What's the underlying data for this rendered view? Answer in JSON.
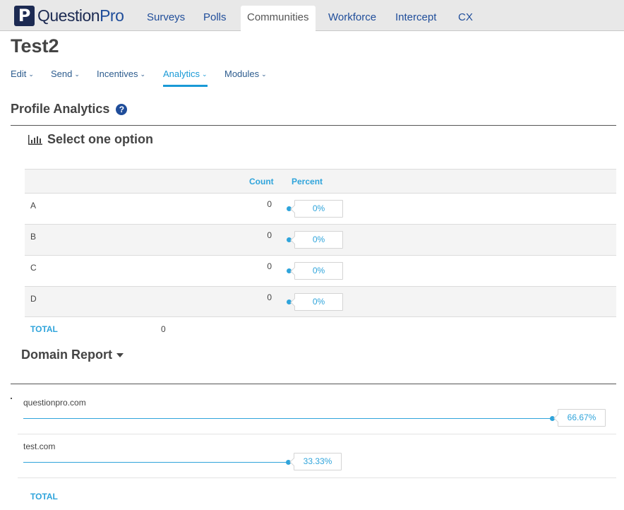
{
  "app": {
    "logo_letter": "P",
    "logo_text_main": "Question",
    "logo_text_accent": "Pro",
    "brand_color": "#1c2a52",
    "accent_color": "#2fa4db"
  },
  "topnav": {
    "items": [
      {
        "label": "Surveys",
        "active": false
      },
      {
        "label": "Polls",
        "active": false
      },
      {
        "label": "Communities",
        "active": true
      },
      {
        "label": "Workforce",
        "active": false
      },
      {
        "label": "Intercept",
        "active": false
      },
      {
        "label": "CX",
        "active": false
      }
    ]
  },
  "page": {
    "title": "Test2"
  },
  "subnav": {
    "items": [
      {
        "label": "Edit",
        "active": false
      },
      {
        "label": "Send",
        "active": false
      },
      {
        "label": "Incentives",
        "active": false
      },
      {
        "label": "Analytics",
        "active": true
      },
      {
        "label": "Modules",
        "active": false
      }
    ],
    "chevron": "⌄"
  },
  "profile_analytics": {
    "title": "Profile Analytics",
    "help_icon": "?",
    "question": {
      "title": "Select one option",
      "icon": "bar-chart-icon",
      "columns": {
        "count": "Count",
        "percent": "Percent"
      },
      "rows": [
        {
          "label": "A",
          "count": "0",
          "percent": "0%",
          "percent_value": 0
        },
        {
          "label": "B",
          "count": "0",
          "percent": "0%",
          "percent_value": 0
        },
        {
          "label": "C",
          "count": "0",
          "percent": "0%",
          "percent_value": 0
        },
        {
          "label": "D",
          "count": "0",
          "percent": "0%",
          "percent_value": 0
        }
      ],
      "total_label": "TOTAL",
      "total_value": "0"
    }
  },
  "domain_report": {
    "title": "Domain Report",
    "rows": [
      {
        "domain": "questionpro.com",
        "percent": "66.67%",
        "percent_value": 66.67
      },
      {
        "domain": "test.com",
        "percent": "33.33%",
        "percent_value": 33.33
      }
    ],
    "total_label": "TOTAL"
  }
}
